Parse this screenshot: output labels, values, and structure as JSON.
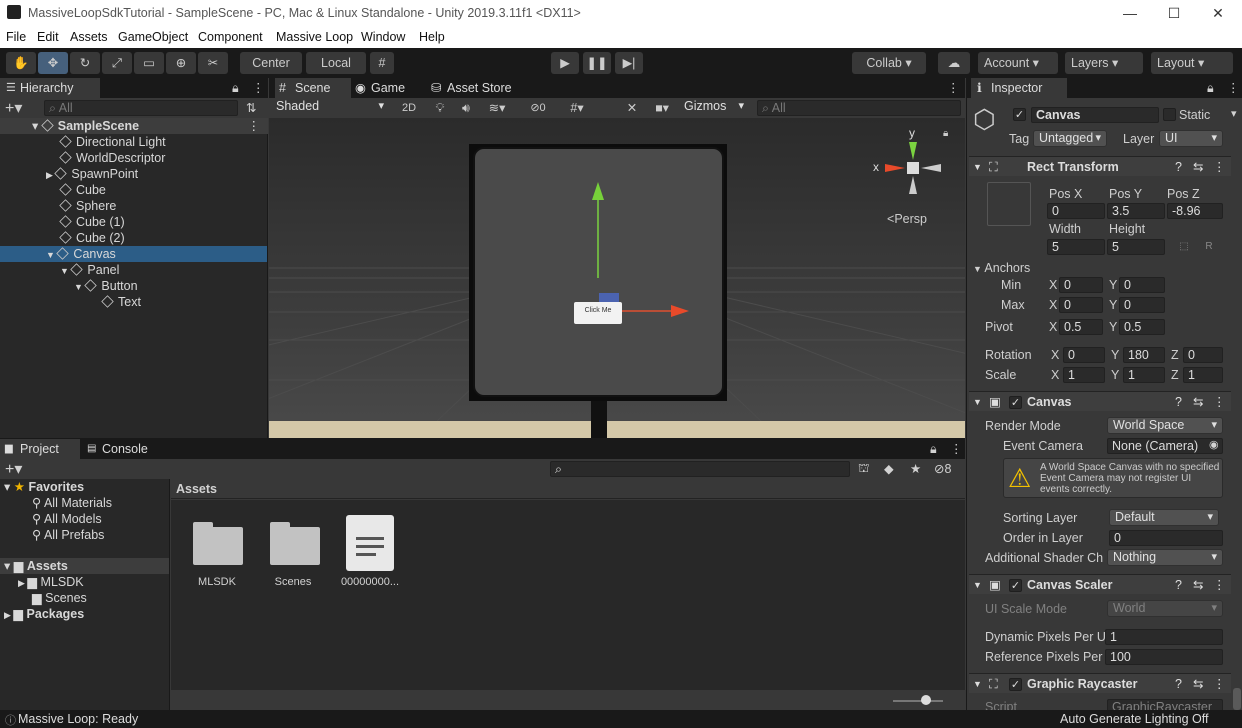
{
  "window": {
    "title": "MassiveLoopSdkTutorial - SampleScene - PC, Mac & Linux Standalone - Unity 2019.3.11f1 <DX11>",
    "minimize": "—",
    "maximize": "☐",
    "close": "✕"
  },
  "menu": [
    "File",
    "Edit",
    "Assets",
    "GameObject",
    "Component",
    "Massive Loop",
    "Window",
    "Help"
  ],
  "toolbar": {
    "center": "Center",
    "local": "Local",
    "collab": "Collab ▾",
    "account": "Account",
    "layers": "Layers",
    "layout": "Layout"
  },
  "hierarchy": {
    "tab": "Hierarchy",
    "search_placeholder": "All",
    "scene": "SampleScene",
    "items": [
      "Directional Light",
      "WorldDescriptor",
      "SpawnPoint",
      "Cube",
      "Sphere",
      "Cube (1)",
      "Cube (2)",
      "Canvas",
      "Panel",
      "Button",
      "Text"
    ]
  },
  "scene_view": {
    "tabs": [
      "Scene",
      "Game",
      "Asset Store"
    ],
    "shading": "Shaded",
    "mode2d": "2D",
    "hidden_count": "0",
    "gizmos": "Gizmos",
    "search_placeholder": "All",
    "button_text": "Click Me",
    "persp": "Persp",
    "axis_x": "x",
    "axis_y": "y"
  },
  "project": {
    "tabs": [
      "Project",
      "Console"
    ],
    "favorites": "Favorites",
    "favorite_items": [
      "All Materials",
      "All Models",
      "All Prefabs"
    ],
    "assets_root": "Assets",
    "asset_children": [
      "MLSDK",
      "Scenes"
    ],
    "packages": "Packages",
    "breadcrumb": "Assets",
    "files": [
      "MLSDK",
      "Scenes",
      "00000000..."
    ],
    "badge_count": "8"
  },
  "inspector": {
    "tab": "Inspector",
    "object_name": "Canvas",
    "static_label": "Static",
    "tag_label": "Tag",
    "tag_value": "Untagged",
    "layer_label": "Layer",
    "layer_value": "UI",
    "rect": {
      "title": "Rect Transform",
      "pos_x_label": "Pos X",
      "pos_y_label": "Pos Y",
      "pos_z_label": "Pos Z",
      "pos_x": "0",
      "pos_y": "3.5",
      "pos_z": "-8.96",
      "width_label": "Width",
      "height_label": "Height",
      "width": "5",
      "height": "5",
      "r": "R",
      "anchors": "Anchors",
      "min": "Min",
      "max": "Max",
      "min_x": "0",
      "min_y": "0",
      "max_x": "0",
      "max_y": "0",
      "pivot": "Pivot",
      "pivot_x": "0.5",
      "pivot_y": "0.5",
      "rotation": "Rotation",
      "rot_x": "0",
      "rot_y": "180",
      "rot_z": "0",
      "scale": "Scale",
      "scale_x": "1",
      "scale_y": "1",
      "scale_z": "1"
    },
    "canvas": {
      "title": "Canvas",
      "render_mode_label": "Render Mode",
      "render_mode": "World Space",
      "event_camera_label": "Event Camera",
      "event_camera": "None (Camera)",
      "warning": "A World Space Canvas with no specified Event Camera may not register UI events correctly.",
      "sorting_layer_label": "Sorting Layer",
      "sorting_layer": "Default",
      "order_label": "Order in Layer",
      "order": "0",
      "shader_label": "Additional Shader Ch",
      "shader": "Nothing"
    },
    "scaler": {
      "title": "Canvas Scaler",
      "ui_scale_label": "UI Scale Mode",
      "ui_scale": "World",
      "dynamic_label": "Dynamic Pixels Per U",
      "dynamic": "1",
      "reference_label": "Reference Pixels Per",
      "reference": "100"
    },
    "raycaster": {
      "title": "Graphic Raycaster",
      "script_label": "Script",
      "script": "GraphicRaycaster"
    }
  },
  "statusbar": {
    "left": "Massive Loop: Ready",
    "right": "Auto Generate Lighting Off"
  }
}
